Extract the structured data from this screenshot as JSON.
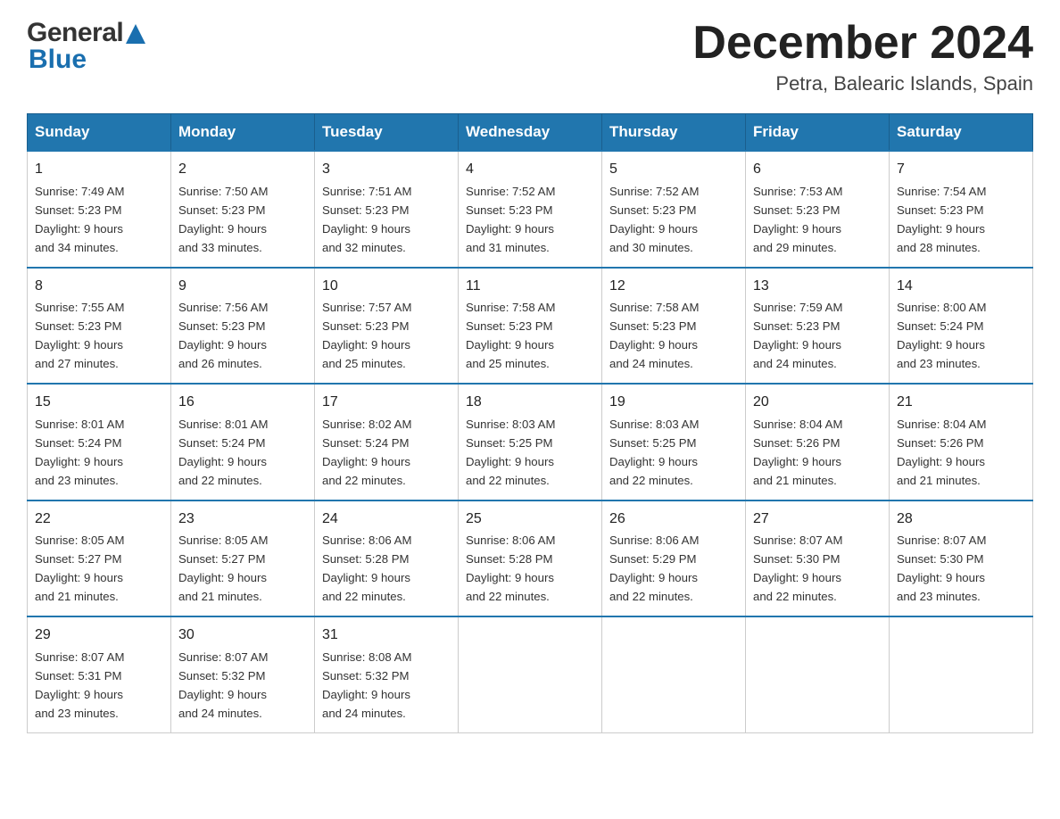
{
  "header": {
    "title": "December 2024",
    "subtitle": "Petra, Balearic Islands, Spain",
    "logo": {
      "general": "General",
      "blue": "Blue"
    }
  },
  "columns": [
    "Sunday",
    "Monday",
    "Tuesday",
    "Wednesday",
    "Thursday",
    "Friday",
    "Saturday"
  ],
  "weeks": [
    [
      {
        "day": "1",
        "sunrise": "7:49 AM",
        "sunset": "5:23 PM",
        "daylight": "9 hours and 34 minutes."
      },
      {
        "day": "2",
        "sunrise": "7:50 AM",
        "sunset": "5:23 PM",
        "daylight": "9 hours and 33 minutes."
      },
      {
        "day": "3",
        "sunrise": "7:51 AM",
        "sunset": "5:23 PM",
        "daylight": "9 hours and 32 minutes."
      },
      {
        "day": "4",
        "sunrise": "7:52 AM",
        "sunset": "5:23 PM",
        "daylight": "9 hours and 31 minutes."
      },
      {
        "day": "5",
        "sunrise": "7:52 AM",
        "sunset": "5:23 PM",
        "daylight": "9 hours and 30 minutes."
      },
      {
        "day": "6",
        "sunrise": "7:53 AM",
        "sunset": "5:23 PM",
        "daylight": "9 hours and 29 minutes."
      },
      {
        "day": "7",
        "sunrise": "7:54 AM",
        "sunset": "5:23 PM",
        "daylight": "9 hours and 28 minutes."
      }
    ],
    [
      {
        "day": "8",
        "sunrise": "7:55 AM",
        "sunset": "5:23 PM",
        "daylight": "9 hours and 27 minutes."
      },
      {
        "day": "9",
        "sunrise": "7:56 AM",
        "sunset": "5:23 PM",
        "daylight": "9 hours and 26 minutes."
      },
      {
        "day": "10",
        "sunrise": "7:57 AM",
        "sunset": "5:23 PM",
        "daylight": "9 hours and 25 minutes."
      },
      {
        "day": "11",
        "sunrise": "7:58 AM",
        "sunset": "5:23 PM",
        "daylight": "9 hours and 25 minutes."
      },
      {
        "day": "12",
        "sunrise": "7:58 AM",
        "sunset": "5:23 PM",
        "daylight": "9 hours and 24 minutes."
      },
      {
        "day": "13",
        "sunrise": "7:59 AM",
        "sunset": "5:23 PM",
        "daylight": "9 hours and 24 minutes."
      },
      {
        "day": "14",
        "sunrise": "8:00 AM",
        "sunset": "5:24 PM",
        "daylight": "9 hours and 23 minutes."
      }
    ],
    [
      {
        "day": "15",
        "sunrise": "8:01 AM",
        "sunset": "5:24 PM",
        "daylight": "9 hours and 23 minutes."
      },
      {
        "day": "16",
        "sunrise": "8:01 AM",
        "sunset": "5:24 PM",
        "daylight": "9 hours and 22 minutes."
      },
      {
        "day": "17",
        "sunrise": "8:02 AM",
        "sunset": "5:24 PM",
        "daylight": "9 hours and 22 minutes."
      },
      {
        "day": "18",
        "sunrise": "8:03 AM",
        "sunset": "5:25 PM",
        "daylight": "9 hours and 22 minutes."
      },
      {
        "day": "19",
        "sunrise": "8:03 AM",
        "sunset": "5:25 PM",
        "daylight": "9 hours and 22 minutes."
      },
      {
        "day": "20",
        "sunrise": "8:04 AM",
        "sunset": "5:26 PM",
        "daylight": "9 hours and 21 minutes."
      },
      {
        "day": "21",
        "sunrise": "8:04 AM",
        "sunset": "5:26 PM",
        "daylight": "9 hours and 21 minutes."
      }
    ],
    [
      {
        "day": "22",
        "sunrise": "8:05 AM",
        "sunset": "5:27 PM",
        "daylight": "9 hours and 21 minutes."
      },
      {
        "day": "23",
        "sunrise": "8:05 AM",
        "sunset": "5:27 PM",
        "daylight": "9 hours and 21 minutes."
      },
      {
        "day": "24",
        "sunrise": "8:06 AM",
        "sunset": "5:28 PM",
        "daylight": "9 hours and 22 minutes."
      },
      {
        "day": "25",
        "sunrise": "8:06 AM",
        "sunset": "5:28 PM",
        "daylight": "9 hours and 22 minutes."
      },
      {
        "day": "26",
        "sunrise": "8:06 AM",
        "sunset": "5:29 PM",
        "daylight": "9 hours and 22 minutes."
      },
      {
        "day": "27",
        "sunrise": "8:07 AM",
        "sunset": "5:30 PM",
        "daylight": "9 hours and 22 minutes."
      },
      {
        "day": "28",
        "sunrise": "8:07 AM",
        "sunset": "5:30 PM",
        "daylight": "9 hours and 23 minutes."
      }
    ],
    [
      {
        "day": "29",
        "sunrise": "8:07 AM",
        "sunset": "5:31 PM",
        "daylight": "9 hours and 23 minutes."
      },
      {
        "day": "30",
        "sunrise": "8:07 AM",
        "sunset": "5:32 PM",
        "daylight": "9 hours and 24 minutes."
      },
      {
        "day": "31",
        "sunrise": "8:08 AM",
        "sunset": "5:32 PM",
        "daylight": "9 hours and 24 minutes."
      },
      null,
      null,
      null,
      null
    ]
  ]
}
